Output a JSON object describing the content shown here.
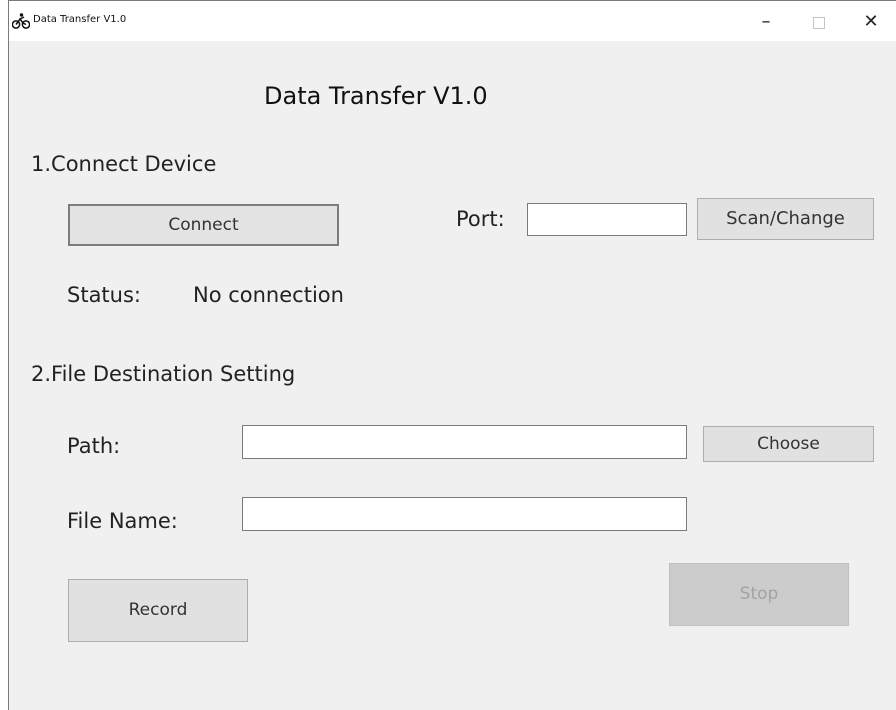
{
  "window": {
    "title": "Data Transfer V1.0",
    "controls": {
      "minimize": "–",
      "maximize": "",
      "close": "✕"
    },
    "icon": "cycling-icon"
  },
  "header": {
    "title": "Data Transfer V1.0"
  },
  "connect_section": {
    "title": "1.Connect Device",
    "connect_label": "Connect",
    "port_label": "Port:",
    "port_value": "",
    "scan_label": "Scan/Change",
    "status_label": "Status:",
    "status_value": "No connection"
  },
  "file_section": {
    "title": "2.File Destination Setting",
    "path_label": "Path:",
    "path_value": "",
    "choose_label": "Choose",
    "filename_label": "File Name:",
    "filename_value": ""
  },
  "actions": {
    "record_label": "Record",
    "stop_label": "Stop",
    "stop_enabled": false
  },
  "colors": {
    "window_bg": "#f0f0f0",
    "button_bg": "#e1e1e1",
    "disabled_bg": "#cccccc",
    "disabled_text": "#a3a3a3"
  }
}
